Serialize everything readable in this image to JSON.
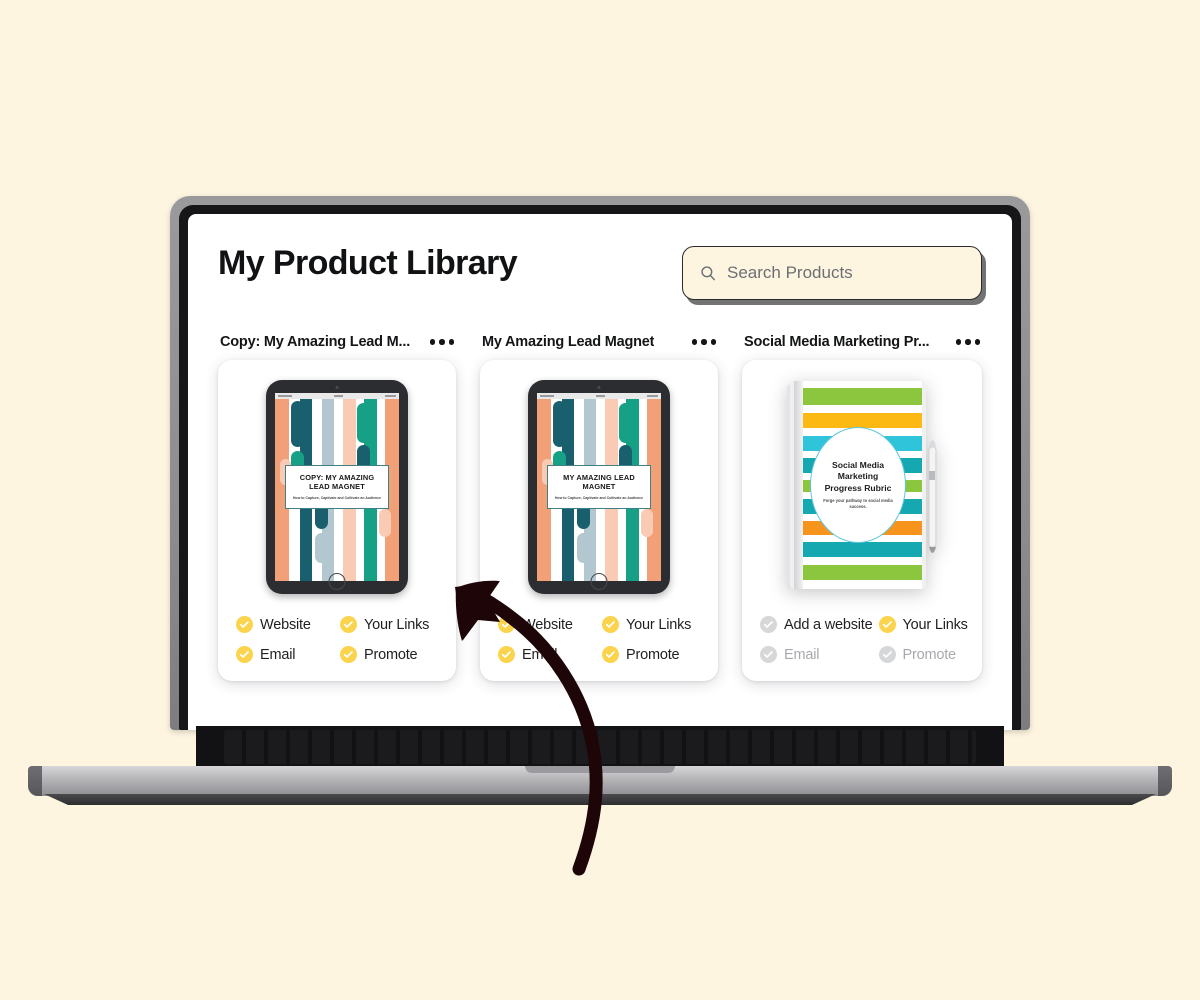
{
  "page": {
    "title": "My Product Library",
    "background_color": "#FDF5E0"
  },
  "search": {
    "placeholder": "Search Products",
    "value": "",
    "icon": "search-icon"
  },
  "theme": {
    "badge_active": "#FBD34D",
    "badge_inactive": "#D6D7D9",
    "accent_teal": "#1A5F6E",
    "accent_green": "#16A085",
    "accent_salmon": "#F2A077",
    "accent_peach": "#F9CBB4",
    "accent_bluegrey": "#B3C7D1",
    "nb_green": "#8CC63F",
    "nb_yellow": "#FDB913",
    "nb_cyan": "#2FC4D9",
    "nb_teal": "#16A8B0",
    "nb_orange": "#F7941E"
  },
  "products": [
    {
      "title": "Copy: My Amazing Lead M...",
      "menu_label": "more-options",
      "mockup": "tablet",
      "cover_title": "COPY: MY AMAZING LEAD MAGNET",
      "cover_subtitle": "How to Capture, Captivate and Cultivate an Audience",
      "statuses": [
        {
          "label": "Website",
          "state": "active"
        },
        {
          "label": "Your Links",
          "state": "active"
        },
        {
          "label": "Email",
          "state": "active"
        },
        {
          "label": "Promote",
          "state": "active"
        }
      ]
    },
    {
      "title": "My Amazing Lead Magnet",
      "menu_label": "more-options",
      "mockup": "tablet",
      "cover_title": "MY AMAZING LEAD MAGNET",
      "cover_subtitle": "How to Capture, Captivate and Cultivate an Audience",
      "statuses": [
        {
          "label": "Website",
          "state": "active"
        },
        {
          "label": "Your Links",
          "state": "active"
        },
        {
          "label": "Email",
          "state": "active"
        },
        {
          "label": "Promote",
          "state": "active"
        }
      ]
    },
    {
      "title": "Social Media Marketing Pr...",
      "menu_label": "more-options",
      "mockup": "notebook",
      "cover_title": "Social Media Marketing Progress Rubric",
      "cover_subtitle": "Forge your pathway to social media success.",
      "statuses": [
        {
          "label": "Add a website",
          "state": "inactive-dark"
        },
        {
          "label": "Your Links",
          "state": "active-dark"
        },
        {
          "label": "Email",
          "state": "inactive"
        },
        {
          "label": "Promote",
          "state": "inactive"
        }
      ]
    }
  ],
  "annotation": {
    "type": "curved-arrow",
    "points_to": "Your Links",
    "color": "#1E0508"
  }
}
